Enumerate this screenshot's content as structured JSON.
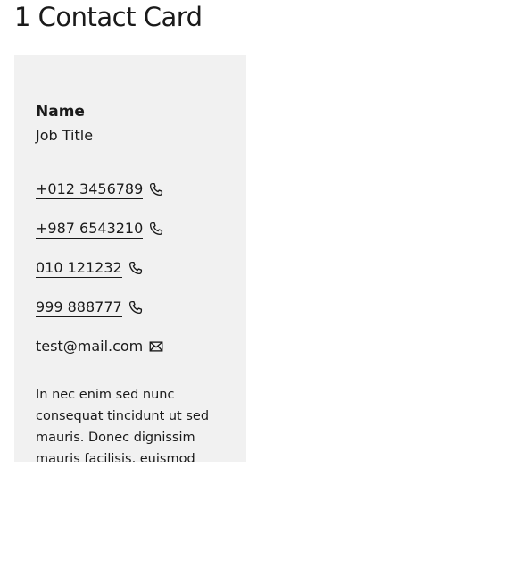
{
  "page": {
    "heading": "1 Contact Card"
  },
  "card": {
    "name": "Name",
    "job_title": "Job Title",
    "contacts": [
      {
        "text": "+012 3456789",
        "icon": "phone-icon"
      },
      {
        "text": "+987 6543210",
        "icon": "phone-icon"
      },
      {
        "text": "010 121232",
        "icon": "phone-icon"
      },
      {
        "text": "999 888777",
        "icon": "phone-icon"
      },
      {
        "text": "test@mail.com",
        "icon": "mail-icon"
      }
    ],
    "description": "In nec enim sed nunc consequat tincidunt ut sed mauris. Donec dignissim mauris facilisis, euismod dolor ut, varius nulla."
  },
  "colors": {
    "card_background": "#f1f1f1",
    "text": "#1a1a1a",
    "page_background": "#ffffff"
  }
}
